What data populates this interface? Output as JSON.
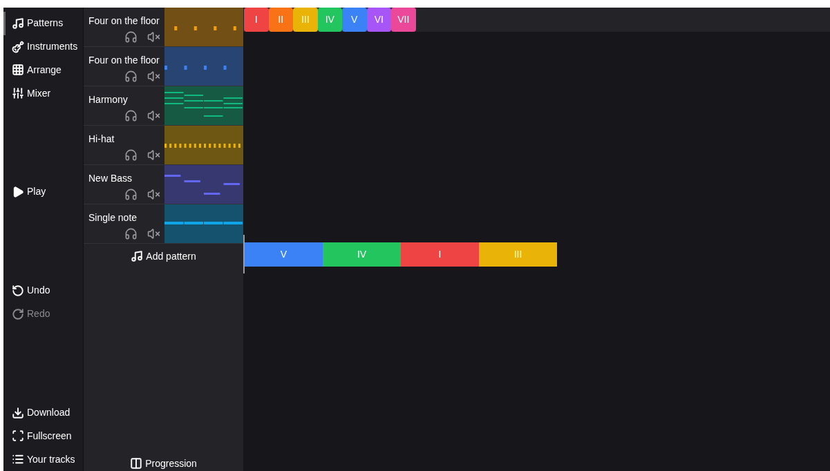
{
  "sidebar": {
    "items": [
      {
        "kind": "patterns",
        "label": "Patterns",
        "selected": true,
        "disabled": false
      },
      {
        "kind": "instruments",
        "label": "Instruments",
        "selected": false,
        "disabled": false
      },
      {
        "kind": "arrange",
        "label": "Arrange",
        "selected": false,
        "disabled": false
      },
      {
        "kind": "mixer",
        "label": "Mixer",
        "selected": false,
        "disabled": false
      },
      {
        "kind": "play",
        "label": "Play",
        "selected": false,
        "disabled": false
      },
      {
        "kind": "undo",
        "label": "Undo",
        "selected": false,
        "disabled": false
      },
      {
        "kind": "redo",
        "label": "Redo",
        "selected": false,
        "disabled": true
      },
      {
        "kind": "download",
        "label": "Download",
        "selected": false,
        "disabled": false
      },
      {
        "kind": "fullscreen",
        "label": "Fullscreen",
        "selected": false,
        "disabled": false
      },
      {
        "kind": "tracks",
        "label": "Your tracks",
        "selected": false,
        "disabled": false
      }
    ]
  },
  "patterns": [
    {
      "name": "Four on the floor",
      "kind": "beat",
      "color": "#f59e0b"
    },
    {
      "name": "Four on the floor",
      "kind": "beat",
      "color": "#3b82f6"
    },
    {
      "name": "Harmony",
      "kind": "chords",
      "color": "#10b981"
    },
    {
      "name": "Hi-hat",
      "kind": "hihat",
      "color": "#eab308"
    },
    {
      "name": "New Bass",
      "kind": "bass",
      "color": "#6366f1"
    },
    {
      "name": "Single note",
      "kind": "single",
      "color": "#0ea5e9"
    }
  ],
  "add_pattern": "Add pattern",
  "progression_button": "Progression",
  "chords": [
    {
      "label": "I",
      "color": "#ef4444"
    },
    {
      "label": "II",
      "color": "#f97316"
    },
    {
      "label": "III",
      "color": "#eab308"
    },
    {
      "label": "IV",
      "color": "#22c55e"
    },
    {
      "label": "V",
      "color": "#3b82f6"
    },
    {
      "label": "VI",
      "color": "#a855f7"
    },
    {
      "label": "VII",
      "color": "#ec4899"
    }
  ],
  "progression": [
    {
      "label": "V",
      "color": "#3b82f6"
    },
    {
      "label": "IV",
      "color": "#22c55e"
    },
    {
      "label": "I",
      "color": "#ef4444"
    },
    {
      "label": "III",
      "color": "#eab308"
    }
  ]
}
